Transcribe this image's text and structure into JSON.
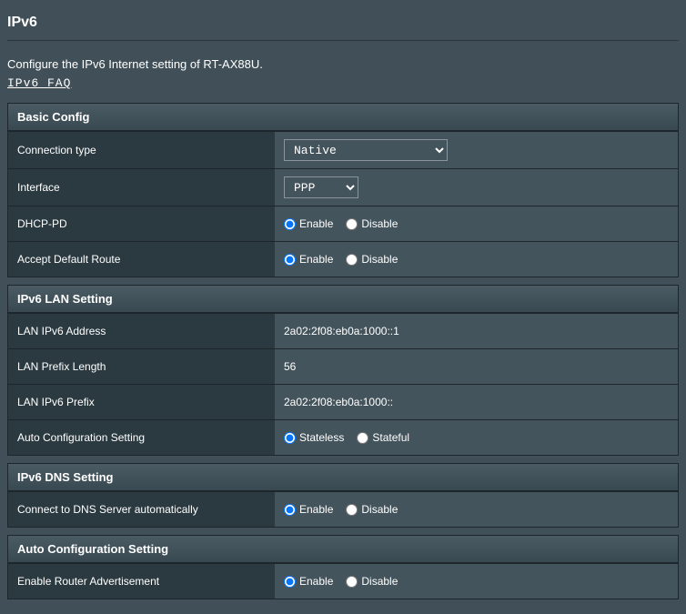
{
  "title": "IPv6",
  "description": "Configure the IPv6 Internet setting of RT-AX88U.",
  "faq": "IPv6 FAQ",
  "sections": {
    "basic": {
      "header": "Basic Config",
      "connection_type_label": "Connection type",
      "connection_type_value": "Native",
      "interface_label": "Interface",
      "interface_value": "PPP",
      "dhcp_pd_label": "DHCP-PD",
      "accept_default_route_label": "Accept Default Route"
    },
    "lan": {
      "header": "IPv6 LAN Setting",
      "lan_addr_label": "LAN IPv6 Address",
      "lan_addr_value": "2a02:2f08:eb0a:1000::1",
      "lan_prefix_len_label": "LAN Prefix Length",
      "lan_prefix_len_value": "56",
      "lan_prefix_label": "LAN IPv6 Prefix",
      "lan_prefix_value": "2a02:2f08:eb0a:1000::",
      "auto_conf_label": "Auto Configuration Setting"
    },
    "dns": {
      "header": "IPv6 DNS Setting",
      "connect_dns_label": "Connect to DNS Server automatically"
    },
    "auto": {
      "header": "Auto Configuration Setting",
      "enable_ra_label": "Enable Router Advertisement"
    }
  },
  "radio": {
    "enable": "Enable",
    "disable": "Disable",
    "stateless": "Stateless",
    "stateful": "Stateful"
  }
}
